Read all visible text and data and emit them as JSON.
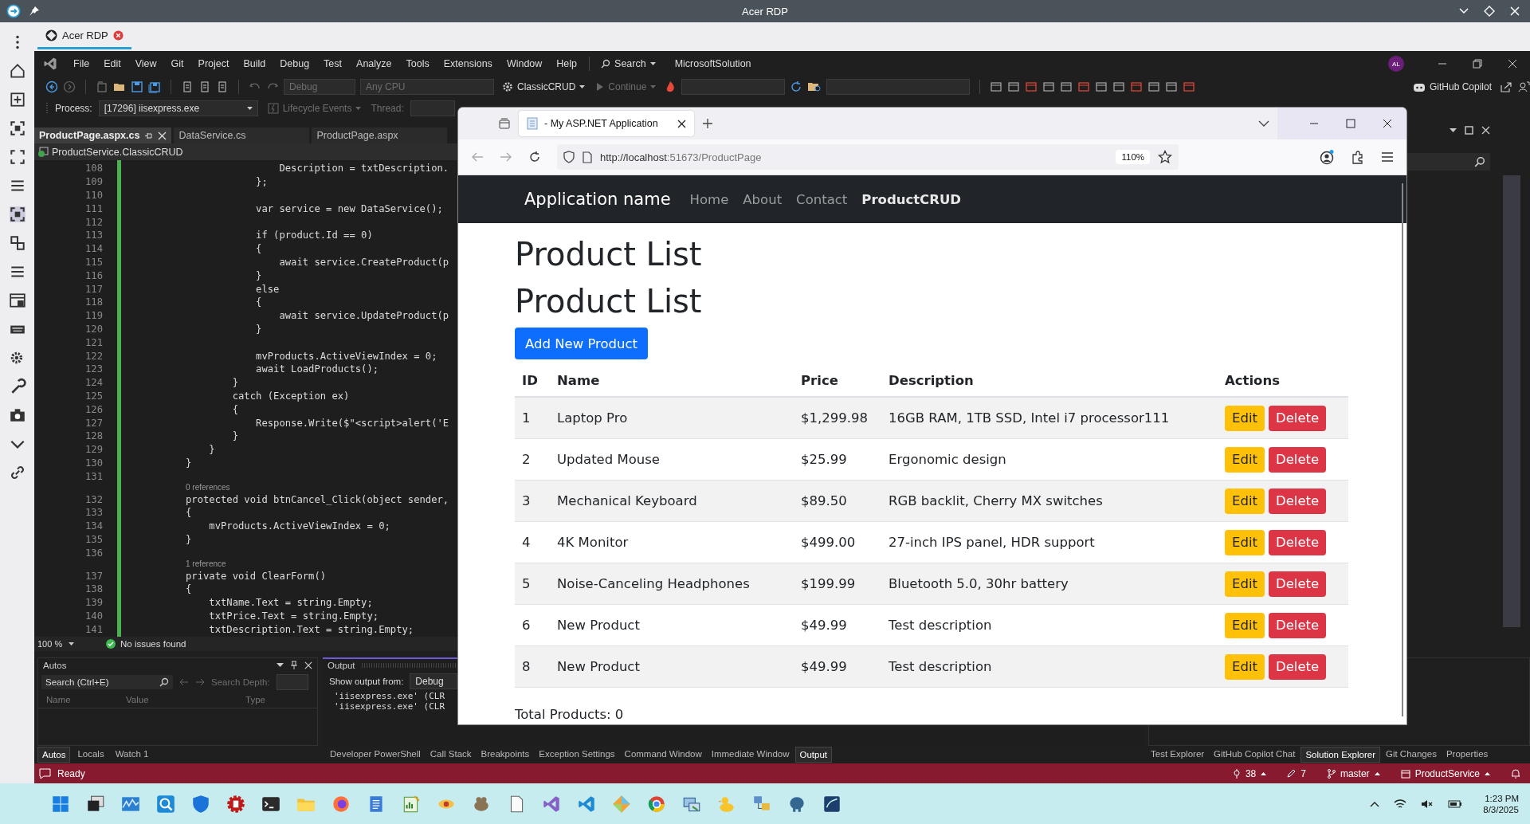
{
  "rdp": {
    "title": "Acer RDP",
    "tab": "Acer RDP"
  },
  "vs": {
    "menu": [
      "File",
      "Edit",
      "View",
      "Git",
      "Project",
      "Build",
      "Debug",
      "Test",
      "Analyze",
      "Tools",
      "Extensions",
      "Window",
      "Help"
    ],
    "search": "Search",
    "solution": "MicrosoftSolution",
    "avatar": "AL",
    "dropdowns": [
      {
        "label": "Debug",
        "disabled": true
      },
      {
        "label": "Any CPU",
        "disabled": true
      }
    ],
    "project": "ClassicCRUD",
    "continue": {
      "label": "Continue",
      "disabled": true
    },
    "copilot": "GitHub Copilot",
    "process_bar": {
      "label": "Process:",
      "process": "[17296] iisexpress.exe",
      "lifecycle": {
        "label": "Lifecycle Events",
        "disabled": true
      },
      "thread": {
        "label": "Thread:",
        "disabled": true
      }
    },
    "editor": {
      "tabs": [
        {
          "label": "ProductPage.aspx.cs",
          "selected": true
        },
        {
          "label": "DataService.cs",
          "selected": false
        },
        {
          "label": "ProductPage.aspx",
          "selected": false
        }
      ],
      "nav": "ProductService.ClassicCRUD",
      "lines": [
        {
          "num": "108",
          "text": "                Description = txtDescription."
        },
        {
          "num": "109",
          "text": "            };"
        },
        {
          "num": "110"
        },
        {
          "num": "111",
          "text": "            var service = new DataService();"
        },
        {
          "num": "112"
        },
        {
          "num": "113",
          "text": "            if (product.Id == 0)"
        },
        {
          "num": "114",
          "text": "            {"
        },
        {
          "num": "115",
          "text": "                await service.CreateProduct(p"
        },
        {
          "num": "116",
          "text": "            }"
        },
        {
          "num": "117",
          "text": "            else"
        },
        {
          "num": "118",
          "text": "            {"
        },
        {
          "num": "119",
          "text": "                await service.UpdateProduct(p"
        },
        {
          "num": "120",
          "text": "            }"
        },
        {
          "num": "121"
        },
        {
          "num": "122",
          "text": "            mvProducts.ActiveViewIndex = 0;"
        },
        {
          "num": "123",
          "text": "            await LoadProducts();"
        },
        {
          "num": "124",
          "text": "        }"
        },
        {
          "num": "125",
          "text": "        catch (Exception ex)"
        },
        {
          "num": "126",
          "text": "        {"
        },
        {
          "num": "127",
          "text": "            Response.Write($\"<script>alert('E"
        },
        {
          "num": "128",
          "text": "        }"
        },
        {
          "num": "129",
          "text": "    }"
        },
        {
          "num": "130",
          "text": "}"
        },
        {
          "num": "131"
        },
        {
          "lens": "0 references"
        },
        {
          "num": "132",
          "text": "protected void btnCancel_Click(object sender,"
        },
        {
          "num": "133",
          "text": "{"
        },
        {
          "num": "134",
          "text": "    mvProducts.ActiveViewIndex = 0;"
        },
        {
          "num": "135",
          "text": "}"
        },
        {
          "num": "136"
        },
        {
          "lens": "1 reference"
        },
        {
          "num": "137",
          "text": "private void ClearForm()"
        },
        {
          "num": "138",
          "text": "{"
        },
        {
          "num": "139",
          "text": "    txtName.Text = string.Empty;"
        },
        {
          "num": "140",
          "text": "    txtPrice.Text = string.Empty;"
        },
        {
          "num": "141",
          "text": "    txtDescription.Text = string.Empty;"
        }
      ],
      "zoom": "100 %",
      "issues": "No issues found"
    },
    "autos": {
      "title": "Autos",
      "search": "Search (Ctrl+E)",
      "depth": "Search Depth:",
      "columns": [
        "Name",
        "Value",
        "Type"
      ],
      "tabs": [
        {
          "label": "Autos",
          "selected": true
        },
        {
          "label": "Locals",
          "selected": false
        },
        {
          "label": "Watch 1",
          "selected": false
        }
      ]
    },
    "output": {
      "title": "Output",
      "from_label": "Show output from:",
      "from": "Debug",
      "lines": [
        "'iisexpress.exe' (CLR",
        "'iisexpress.exe' (CLR"
      ]
    },
    "bottom_tabs": [
      {
        "label": "Developer PowerShell",
        "selected": false
      },
      {
        "label": "Call Stack",
        "selected": false
      },
      {
        "label": "Breakpoints",
        "selected": false
      },
      {
        "label": "Exception Settings",
        "selected": false
      },
      {
        "label": "Command Window",
        "selected": false
      },
      {
        "label": "Immediate Window",
        "selected": false
      },
      {
        "label": "Output",
        "selected": true
      }
    ],
    "side_tabs": [
      {
        "label": "Test Explorer",
        "selected": false
      },
      {
        "label": "GitHub Copilot Chat",
        "selected": false
      },
      {
        "label": "Solution Explorer",
        "selected": true
      },
      {
        "label": "Git Changes",
        "selected": false
      },
      {
        "label": "Properties",
        "selected": false
      }
    ],
    "status": {
      "text": "Ready",
      "errors": "38",
      "changes": "7",
      "branch": "master",
      "repo": "ProductService"
    }
  },
  "browser": {
    "tab": "- My ASP.NET Application",
    "url_host": "http://localhost",
    "url_rest": ":51673/ProductPage",
    "zoom": "110%",
    "page": {
      "brand": "Application name",
      "nav": [
        {
          "label": "Home",
          "selected": false
        },
        {
          "label": "About",
          "selected": false
        },
        {
          "label": "Contact",
          "selected": false
        },
        {
          "label": "ProductCRUD",
          "selected": true
        }
      ],
      "headings": [
        "Product List",
        "Product List"
      ],
      "add_button": "Add New Product",
      "columns": [
        "ID",
        "Name",
        "Price",
        "Description",
        "Actions"
      ],
      "rows": [
        {
          "id": "1",
          "name": "Laptop Pro",
          "price": "$1,299.98",
          "description": "16GB RAM, 1TB SSD, Intel i7 processor111",
          "edit": "Edit",
          "delete": "Delete"
        },
        {
          "id": "2",
          "name": "Updated Mouse",
          "price": "$25.99",
          "description": "Ergonomic design",
          "edit": "Edit",
          "delete": "Delete"
        },
        {
          "id": "3",
          "name": "Mechanical Keyboard",
          "price": "$89.50",
          "description": "RGB backlit, Cherry MX switches",
          "edit": "Edit",
          "delete": "Delete"
        },
        {
          "id": "4",
          "name": "4K Monitor",
          "price": "$499.00",
          "description": "27-inch IPS panel, HDR support",
          "edit": "Edit",
          "delete": "Delete"
        },
        {
          "id": "5",
          "name": "Noise-Canceling Headphones",
          "price": "$199.99",
          "description": "Bluetooth 5.0, 30hr battery",
          "edit": "Edit",
          "delete": "Delete"
        },
        {
          "id": "6",
          "name": "New Product",
          "price": "$49.99",
          "description": "Test description",
          "edit": "Edit",
          "delete": "Delete"
        },
        {
          "id": "8",
          "name": "New Product",
          "price": "$49.99",
          "description": "Test description",
          "edit": "Edit",
          "delete": "Delete"
        }
      ],
      "total": "Total Products: 0"
    }
  },
  "taskbar": {
    "time": "1:23 PM",
    "date": "8/3/2025"
  }
}
